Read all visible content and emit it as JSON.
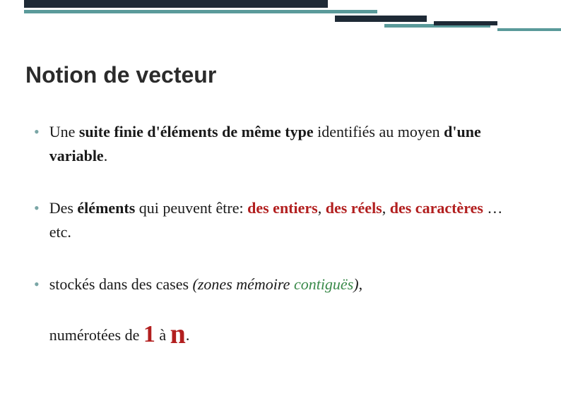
{
  "title": "Notion de vecteur",
  "bullets": {
    "b1": {
      "t1": "Une ",
      "t2": "suite finie d'éléments de même type",
      "t3": " identifiés au moyen ",
      "t4": "d'une variable",
      "t5": "."
    },
    "b2": {
      "t1": "Des ",
      "t2": "éléments",
      "t3": " qui peuvent être: ",
      "t4": "des entiers",
      "t5": ", ",
      "t6": "des réels",
      "t7": ", ",
      "t8": "des caractères",
      "t9": " … etc."
    },
    "b3": {
      "t1": "stockés dans des cases ",
      "t2": "(zones mémoire ",
      "t3": "contiguës",
      "t4": ")",
      "t5": ",",
      "sub1": "numérotées de ",
      "sub2": "1",
      "sub3": "  à  ",
      "sub4": "n",
      "sub5": "."
    }
  }
}
